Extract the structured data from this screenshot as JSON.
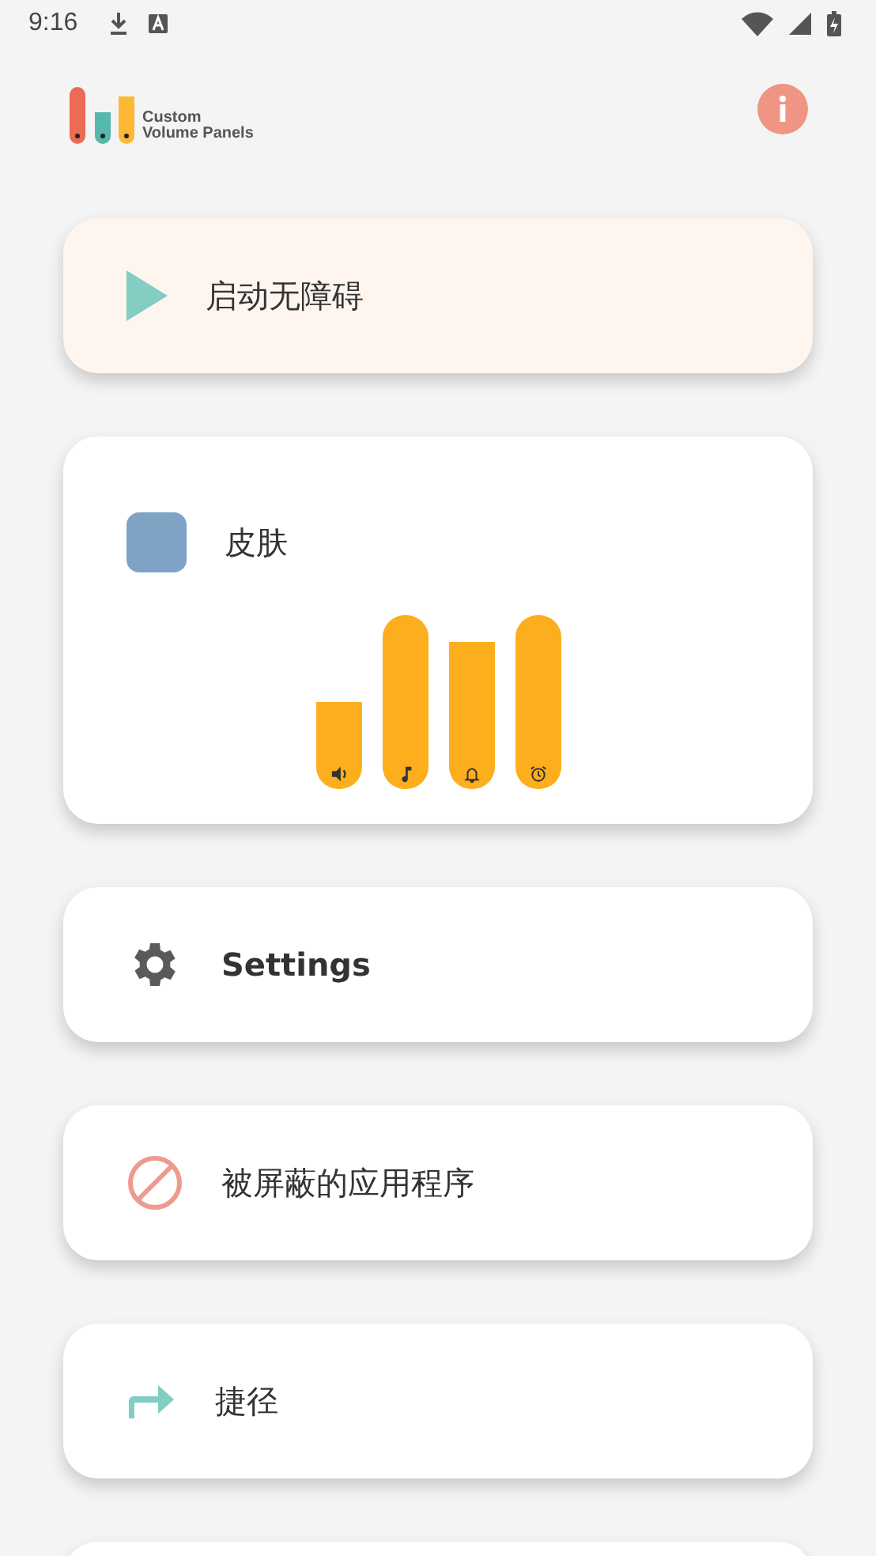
{
  "status_bar": {
    "time": "9:16"
  },
  "header": {
    "logo_lines": [
      "Custom",
      "Volume Panels"
    ]
  },
  "cards": [
    {
      "kind": "start",
      "label": "启动无障碍"
    },
    {
      "kind": "skin",
      "label": "皮肤",
      "sliders": [
        {
          "kind": "speaker",
          "level": 0.5
        },
        {
          "kind": "music",
          "level": 1
        },
        {
          "kind": "ring",
          "level": 0.85
        },
        {
          "kind": "alarm",
          "level": 1
        }
      ]
    },
    {
      "kind": "settings",
      "label": "Settings"
    },
    {
      "kind": "blocked",
      "label": "被屏蔽的应用程序"
    },
    {
      "kind": "shortcut",
      "label": "捷径"
    }
  ]
}
